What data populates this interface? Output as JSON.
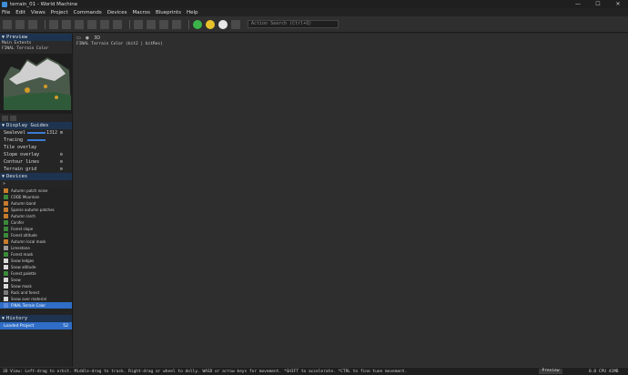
{
  "window": {
    "title": "terrain_01 - World Machine",
    "controls": [
      "—",
      "☐",
      "✕"
    ]
  },
  "menu": [
    "File",
    "Edit",
    "Views",
    "Project",
    "Commands",
    "Devices",
    "Macros",
    "Blueprints",
    "Help"
  ],
  "toolbar": {
    "search_placeholder": "Action Search (Ctrl+Q)"
  },
  "sidebar": {
    "preview": {
      "heading": "Preview",
      "extents": "Main Extents",
      "layer": "FINAL Terrain Color"
    },
    "guides": {
      "heading": "Display Guides",
      "rows": [
        {
          "label": "Sealevel",
          "value": "1312 m"
        },
        {
          "label": "Tracing",
          "value": ""
        },
        {
          "label": "Tile overlay",
          "value": ""
        },
        {
          "label": "Slope overlay",
          "value": ""
        },
        {
          "label": "Contour lines",
          "value": ""
        },
        {
          "label": "Terrain grid",
          "value": ""
        }
      ]
    },
    "devices": {
      "heading": "Devices",
      "items": [
        {
          "label": "Autumn patch noise",
          "color": "#c77b2c"
        },
        {
          "label": "CODE Mountain",
          "color": "#3a8a3a"
        },
        {
          "label": "Autumn band",
          "color": "#c77b2c"
        },
        {
          "label": "Sparse autumn patches",
          "color": "#c77b2c"
        },
        {
          "label": "Autumn larch",
          "color": "#c77b2c"
        },
        {
          "label": "Conifer",
          "color": "#3a8a3a"
        },
        {
          "label": "Forest slope",
          "color": "#3a8a3a"
        },
        {
          "label": "Forest altitude",
          "color": "#3a8a3a"
        },
        {
          "label": "Autumn local mask",
          "color": "#c77b2c"
        },
        {
          "label": "Limestone",
          "color": "#9a9a9a"
        },
        {
          "label": "Forest mask",
          "color": "#3a8a3a"
        },
        {
          "label": "Snow ledges",
          "color": "#d8d8d8"
        },
        {
          "label": "Snow altitude",
          "color": "#d8d8d8"
        },
        {
          "label": "Forest palette",
          "color": "#3a8a3a"
        },
        {
          "label": "Snow",
          "color": "#d8d8d8"
        },
        {
          "label": "Snow mask",
          "color": "#d8d8d8"
        },
        {
          "label": "Rock and forest",
          "color": "#7a7a7a"
        },
        {
          "label": "Snow over material",
          "color": "#d8d8d8"
        },
        {
          "label": "FINAL Terrain Color",
          "color": "#5a8ad8"
        }
      ],
      "selected_index": 18
    },
    "history": {
      "heading": "History",
      "item": "Loaded Project",
      "count": "52"
    }
  },
  "viewport": {
    "mode": "3D",
    "label": "FINAL Terrain Color (bit2 | bitRes)"
  },
  "status": {
    "text": "3D View: Left-drag to orbit. Middle-drag to track. Right-drag or wheel to dolly. WASD or arrow keys for movement. *SHIFT to accelerate. *CTRL to fine tune movement.",
    "preview": "Preview",
    "cpu": "0.0 CPU 41MB"
  }
}
